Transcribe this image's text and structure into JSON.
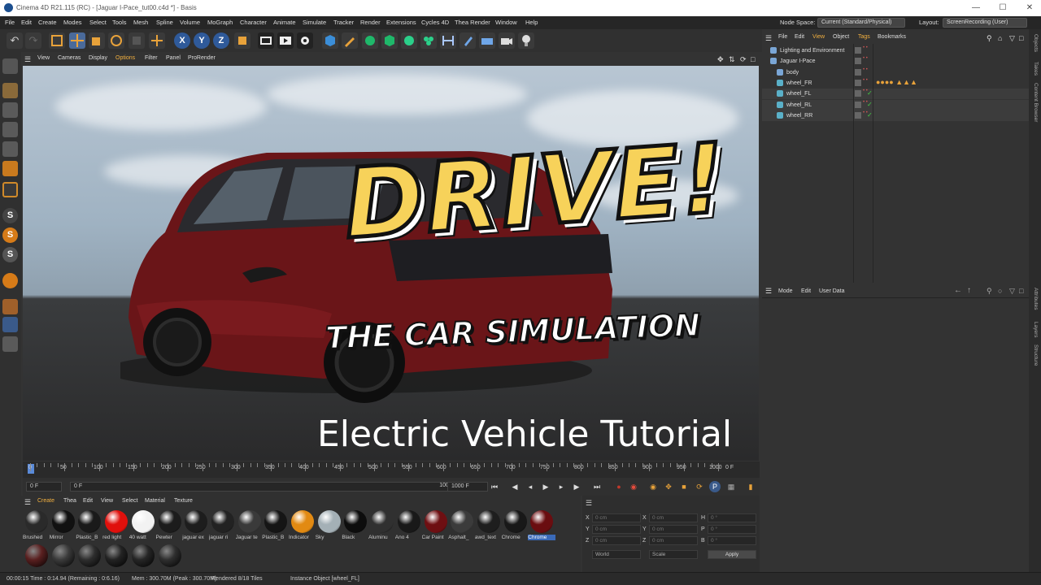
{
  "window": {
    "title": "Cinema 4D R21.115 (RC) - [Jaguar I-Pace_tut00.c4d *] - Basis"
  },
  "menu": {
    "items": [
      "File",
      "Edit",
      "Create",
      "Modes",
      "Select",
      "Tools",
      "Mesh",
      "Spline",
      "Volume",
      "MoGraph",
      "Character",
      "Animate",
      "Simulate",
      "Tracker",
      "Render",
      "Extensions",
      "Cycles 4D",
      "Thea Render",
      "Window",
      "Help"
    ],
    "node_space_label": "Node Space:",
    "node_space_value": "Current (Standard/Physical)",
    "layout_label": "Layout:",
    "layout_value": "ScreenRecording (User)"
  },
  "viewport": {
    "menu": [
      "View",
      "Cameras",
      "Display",
      "Options",
      "Filter",
      "Panel",
      "ProRender"
    ],
    "title_main": "DRIVE!",
    "title_sub": "THE CAR SIMULATION",
    "title_caption": "Electric Vehicle Tutorial"
  },
  "timeline": {
    "ticks": [
      "0",
      "50",
      "100",
      "150",
      "200",
      "250",
      "300",
      "350",
      "400",
      "450",
      "500",
      "550",
      "600",
      "650",
      "700",
      "750",
      "800",
      "850",
      "900",
      "950",
      "1000"
    ],
    "end_frame": "0 F"
  },
  "transport": {
    "start": "0 F",
    "min": "0 F",
    "max": "1000 F",
    "end": "1000 F"
  },
  "materials": {
    "menu": [
      "Create",
      "Thea",
      "Edit",
      "View",
      "Select",
      "Material",
      "Texture"
    ],
    "items": [
      {
        "label": "Brushed",
        "color": "#2a2a2a"
      },
      {
        "label": "Mirror",
        "color": "#111111"
      },
      {
        "label": "Plastic_B",
        "color": "#1a1a1a"
      },
      {
        "label": "red light",
        "color": "#e0100c"
      },
      {
        "label": "40 watt",
        "color": "#f2f2f2"
      },
      {
        "label": "Pewter",
        "color": "#1c1c1c"
      },
      {
        "label": "jaguar ex",
        "color": "#1d1d1d"
      },
      {
        "label": "jaguar ri",
        "color": "#222222"
      },
      {
        "label": "Jaguar te",
        "color": "#3a3a3a"
      },
      {
        "label": "Plastic_B",
        "color": "#151515"
      },
      {
        "label": "Indicator",
        "color": "#e28a12"
      },
      {
        "label": "Sky",
        "color": "#a4b0b6"
      },
      {
        "label": "Black",
        "color": "#0d0d0d"
      },
      {
        "label": "Aluminu",
        "color": "#303030"
      },
      {
        "label": "Ano 4",
        "color": "#191919"
      },
      {
        "label": "Car Paint",
        "color": "#6e0f12"
      },
      {
        "label": "Asphalt_",
        "color": "#3b3b3b"
      },
      {
        "label": "awd_text",
        "color": "#1e1e1e"
      },
      {
        "label": "Chrome",
        "color": "#181818"
      },
      {
        "label": "Chrome",
        "color": "#6a0d10"
      }
    ],
    "row2": [
      "#5a2020",
      "#3b3b3b",
      "#2e2e2e",
      "#232323",
      "#262626",
      "#2f2f2f"
    ]
  },
  "coords": {
    "pos_x": "0 cm",
    "pos_y": "0 cm",
    "pos_z": "0 cm",
    "size_x": "0 cm",
    "size_y": "0 cm",
    "size_z": "0 cm",
    "rot_h": "0 °",
    "rot_p": "0 °",
    "rot_b": "0 °",
    "labels": {
      "x": "X",
      "y": "Y",
      "z": "Z",
      "h": "H",
      "p": "P",
      "b": "B"
    },
    "mode1": "World",
    "mode2": "Scale",
    "apply": "Apply"
  },
  "status": {
    "time": "00:00:15 Time : 0:14.94 (Remaining : 0:6.16)",
    "mem": "Mem : 300.70M (Peak : 300.70M)",
    "render": "Rendered 8/18 Tiles",
    "instance": "Instance Object [wheel_FL]"
  },
  "objects": {
    "menu": [
      "File",
      "Edit",
      "View",
      "Object",
      "Tags",
      "Bookmarks"
    ],
    "rows": [
      {
        "label": "Lighting and Environment",
        "indent": 0
      },
      {
        "label": "Jaguar I-Pace",
        "indent": 0
      },
      {
        "label": "body",
        "indent": 1
      },
      {
        "label": "wheel_FR",
        "indent": 1
      },
      {
        "label": "wheel_FL",
        "indent": 1
      },
      {
        "label": "wheel_RL",
        "indent": 1
      },
      {
        "label": "wheel_RR",
        "indent": 1
      }
    ]
  },
  "attributes": {
    "menu": [
      "Mode",
      "Edit",
      "User Data"
    ]
  },
  "side_tabs": {
    "top": [
      "Objects",
      "Takes",
      "Content Browser"
    ],
    "bottom": [
      "Attributes",
      "Layers",
      "Structure"
    ]
  }
}
